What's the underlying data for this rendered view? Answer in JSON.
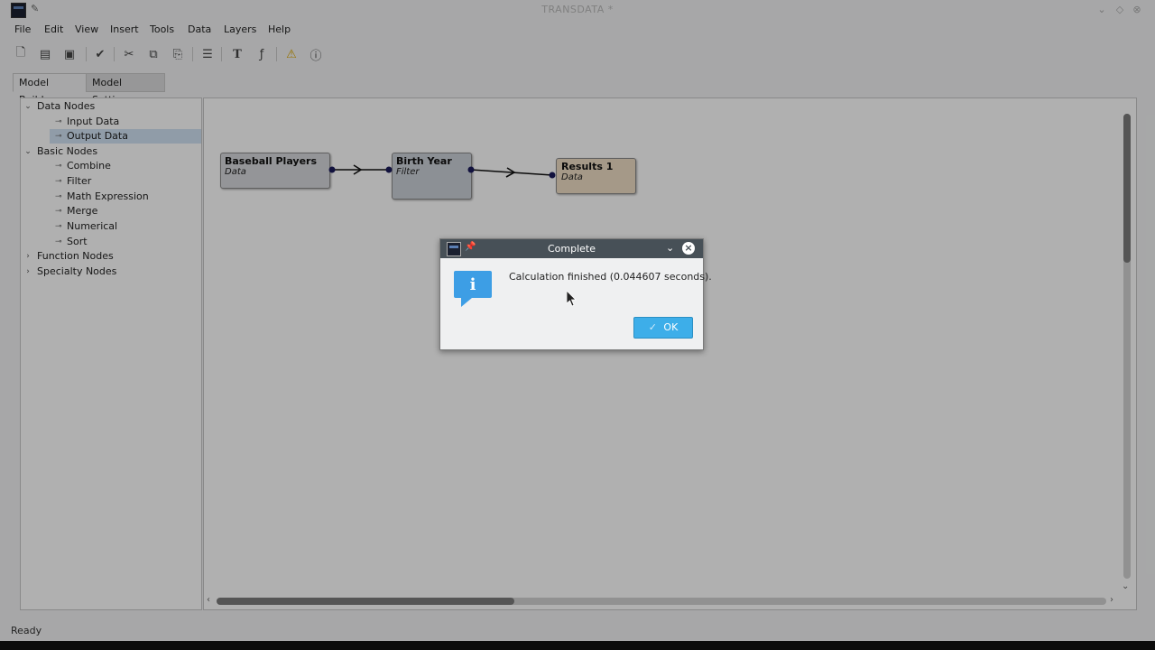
{
  "window": {
    "title": "TRANSDATA *"
  },
  "menu": [
    "File",
    "Edit",
    "View",
    "Insert",
    "Tools",
    "Data",
    "Layers",
    "Help"
  ],
  "toolbar": {
    "text_tool_glyph": "T"
  },
  "tabs": [
    {
      "label": "Model Builder"
    },
    {
      "label": "Model Settings"
    }
  ],
  "tree": {
    "data_nodes": {
      "label": "Data Nodes",
      "items": [
        "Input Data",
        "Output Data"
      ]
    },
    "basic_nodes": {
      "label": "Basic Nodes",
      "items": [
        "Combine",
        "Filter",
        "Math Expression",
        "Merge",
        "Numerical",
        "Sort"
      ]
    },
    "function_nodes": {
      "label": "Function Nodes"
    },
    "specialty_nodes": {
      "label": "Specialty Nodes"
    }
  },
  "nodes": [
    {
      "title": "Baseball Players",
      "type": "Data",
      "color": "#d4d6da"
    },
    {
      "title": "Birth Year",
      "type": "Filter",
      "color": "#c9ced6"
    },
    {
      "title": "Results 1",
      "type": "Data",
      "color": "#ecdcc3"
    }
  ],
  "dialog": {
    "title": "Complete",
    "message": "Calculation finished (0.044607 seconds).",
    "ok_label": "OK",
    "ok_icon": "✓"
  },
  "status": "Ready",
  "colors": {
    "accent": "#3daee9",
    "dialog_title_bar": "#475057",
    "info_icon": "#3d9ee5"
  }
}
